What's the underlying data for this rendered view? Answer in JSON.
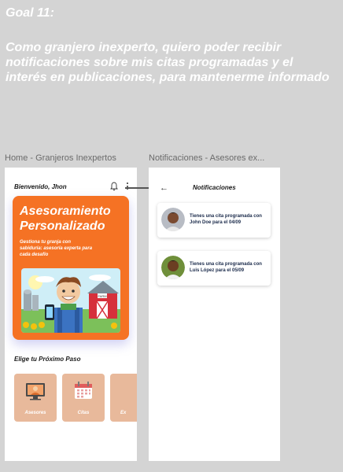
{
  "goal": {
    "title": "Goal 11:",
    "text": "Como granjero inexperto, quiero poder recibir notificaciones sobre mis citas programadas y el interés en publicaciones, para mantenerme informado"
  },
  "frames": {
    "home_label": "Home - Granjeros Inexpertos",
    "notifications_label": "Notificaciones - Asesores ex..."
  },
  "home": {
    "greeting": "Bienvenido, Jhon",
    "hero_title": "Asesoramiento Personalizado",
    "hero_subtitle": "Gestiona tu granja con sabiduría: asesoría experta para cada desafío",
    "barn_sign": "FARM",
    "next_step_heading": "Elige tu Próximo Paso",
    "cards": [
      {
        "label": "Asesores",
        "icon": "advisor-icon"
      },
      {
        "label": "Citas",
        "icon": "calendar-icon"
      },
      {
        "label": "Ex",
        "icon": "partial-icon"
      }
    ]
  },
  "notifications": {
    "title": "Notificaciones",
    "items": [
      {
        "text": "Tienes una cita programada con John Doe para el 04/09"
      },
      {
        "text": "Tienes una cita programada con Luis López para el 05/09"
      }
    ]
  },
  "colors": {
    "accent": "#f57224",
    "card": "#e8b99b",
    "background": "#d4d4d4"
  }
}
